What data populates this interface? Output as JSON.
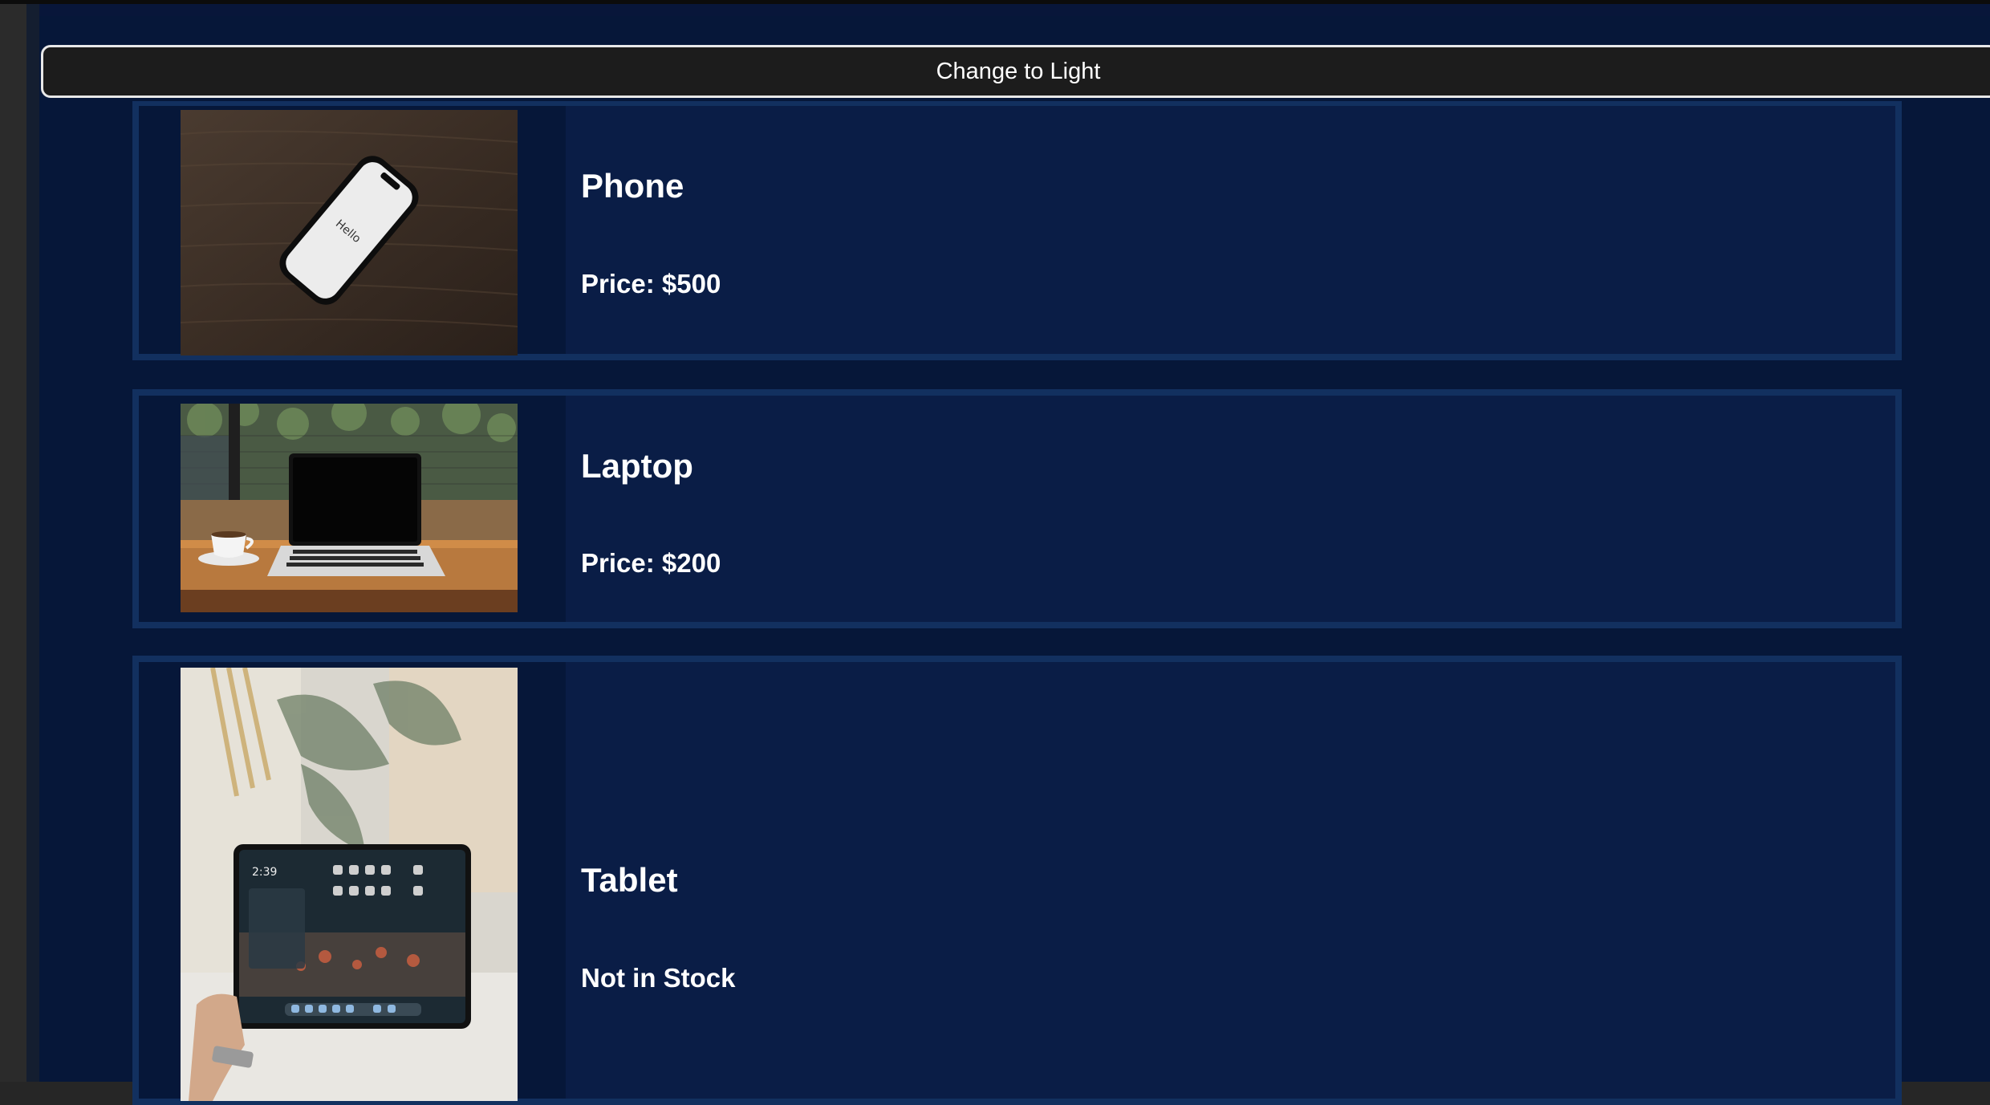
{
  "theme_toggle": {
    "label": "Change to Light"
  },
  "products": [
    {
      "name": "Phone",
      "status": "Price: $500",
      "image": "phone-photo",
      "phone_screen_text": "Hello"
    },
    {
      "name": "Laptop",
      "status": "Price: $200",
      "image": "laptop-photo"
    },
    {
      "name": "Tablet",
      "status": "Not in Stock",
      "image": "tablet-photo",
      "tablet_clock": "2:39"
    }
  ],
  "colors": {
    "page_background": "#061739",
    "card_background": "#0a1d46",
    "card_border": "#12305f",
    "button_background": "#1c1c1c",
    "button_border": "#e8e8e8",
    "text": "#ffffff"
  }
}
